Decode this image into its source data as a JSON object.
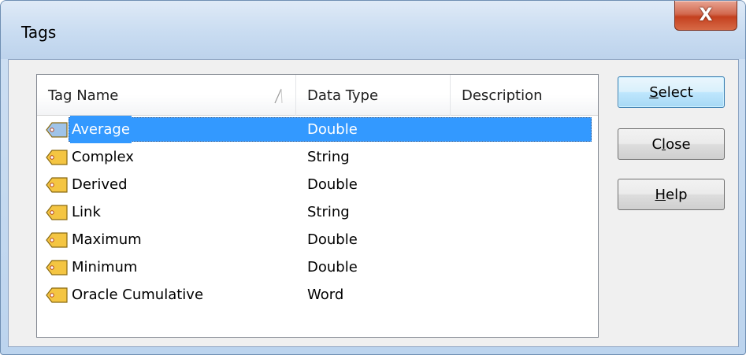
{
  "window": {
    "title": "Tags",
    "close_label": "X"
  },
  "list": {
    "columns": [
      {
        "label": "Tag Name",
        "sorted": "ascending"
      },
      {
        "label": "Data Type"
      },
      {
        "label": "Description"
      }
    ],
    "rows": [
      {
        "name": "Average",
        "type": "Double",
        "description": "",
        "selected": true,
        "icon": "tag-icon"
      },
      {
        "name": "Complex",
        "type": "String",
        "description": "",
        "icon": "tag-icon"
      },
      {
        "name": "Derived",
        "type": "Double",
        "description": "",
        "icon": "tag-icon"
      },
      {
        "name": "Link",
        "type": "String",
        "description": "",
        "icon": "tag-icon"
      },
      {
        "name": "Maximum",
        "type": "Double",
        "description": "",
        "icon": "tag-icon"
      },
      {
        "name": "Minimum",
        "type": "Double",
        "description": "",
        "icon": "tag-icon"
      },
      {
        "name": "Oracle Cumulative",
        "type": "Word",
        "description": "",
        "icon": "tag-icon"
      }
    ]
  },
  "buttons": {
    "select": {
      "mnemonic": "S",
      "rest": "elect"
    },
    "close": {
      "pre": "C",
      "mnemonic": "l",
      "rest": "ose"
    },
    "help": {
      "mnemonic": "H",
      "rest": "elp"
    }
  },
  "colors": {
    "selection": "#3399ff",
    "close_button": "#c4401f",
    "tag_icon_fill": "#f4c542"
  }
}
